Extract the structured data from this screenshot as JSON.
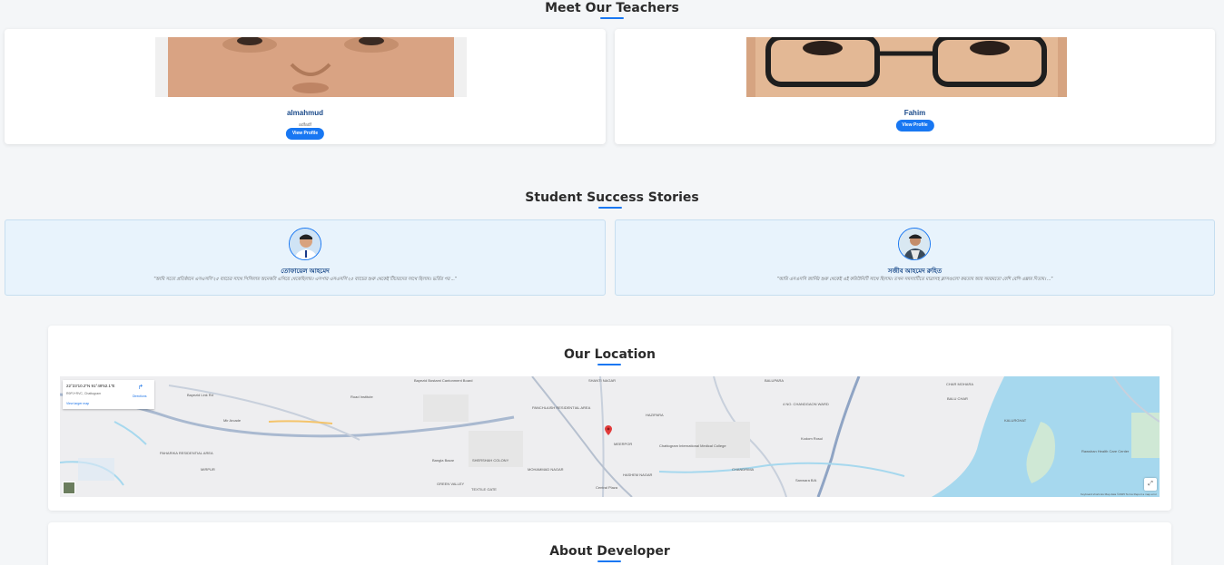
{
  "teachers_section": {
    "title": "Meet Our Teachers",
    "teachers": [
      {
        "name": "almahmud",
        "subtitle": "adfadf",
        "button": "View Profile"
      },
      {
        "name": "Fahim",
        "button": "View Profile"
      }
    ]
  },
  "stories_section": {
    "title": "Student Success Stories",
    "stories": [
      {
        "name": "তোফায়েল আহমেদ",
        "quote": "\"আমি সত্যে প্রতিষ্ঠানে এসএসসি'২৫ ব্যাচের সাথে পিসিলাম অনেকটা এগিয়ে থেকেছিলাম। এসপার এসএসসি'২৫ ব্যাচের শুরু থেকেই টিচারদের সাথে ছিলাম। ভর্তির পর ...\""
      },
      {
        "name": "সজীব আহমেদ রুহিত",
        "quote": "\"আমি এসএসসি জার্নির শুরু থেকেই এই কমিউনিটি সাথে ছিলাম। তখন সমস্যাটিতে মাত্রাসহ ক্লাসগুলো করতাম আর সময়মতো বেশি বেশি এক্সাম দিতাম। ...\""
      }
    ]
  },
  "location_section": {
    "title": "Our Location",
    "map": {
      "coords": "22°23'10.2\"N 91°49'52.1\"E",
      "place": "R9PJ+RVC, Chattogram",
      "link": "View larger map",
      "directions": "Directions",
      "footer": "Keyboard shortcuts   Map data ©2025   Terms   Report a map error",
      "labels": {
        "cantonment": "Bayezid Bostami Cantonment Board",
        "shanti": "SHANTI NAGAR",
        "balupara": "BALUPARA",
        "char_mohara": "CHAR MOHARA",
        "bayezid": "Bayezid Link Rd",
        "hazipara": "HAZIPARA",
        "chandgaon": "4 NO. CHANDGAON WARD",
        "balu_char": "BALU CHAR",
        "panchlaish": "PANCHLAISH RESIDENTIAL AREA",
        "moddhom": "MEERPOR",
        "hospital": "Chattogram International Medical College",
        "hashem": "HASHEM NAGAR",
        "chandrima": "CHANDRIMA",
        "sholoshohor": "SHERSHAH COLONY",
        "mohammad": "MOHAMMAD NAGAR",
        "textile": "TEXTILE GATE",
        "green": "GREEN VALLEY",
        "mir": "Mir Arcade",
        "bazar": "Bangla Bazar",
        "new_market": "Road Institute",
        "kalurghat": "KALURGHAT",
        "pahartali": "PAHARIKA RESIDENTIAL AREA",
        "mirpur": "MIRPUR",
        "hill": "Kodom Rosul",
        "char_p": "Sanwara B/A",
        "central": "Central Plaza",
        "salehin": "Rawshan Health Care Center"
      }
    }
  },
  "developer_section": {
    "title": "About Developer"
  },
  "colors": {
    "accent": "#1877f2",
    "story_bg": "#e8f3fc",
    "water": "#a6d8ee"
  }
}
